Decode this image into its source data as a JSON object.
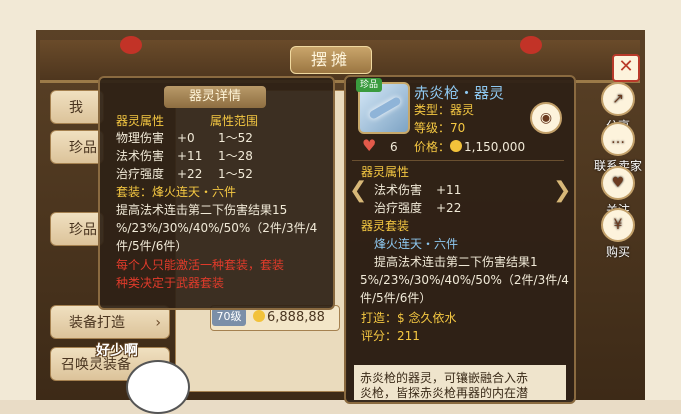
{
  "stall": {
    "title": "摆摊",
    "close_label": "✕"
  },
  "tabs": [
    {
      "label": "我"
    },
    {
      "label": "珍品"
    },
    {
      "label": "珍品"
    },
    {
      "label": "装备打造"
    },
    {
      "label": "召唤灵装备"
    }
  ],
  "shop": {
    "level": "70级",
    "price": "6,888,88"
  },
  "side_buttons": [
    {
      "label": "分享",
      "icon": "share-icon"
    },
    {
      "label": "联系卖家",
      "icon": "chat-icon"
    },
    {
      "label": "关注",
      "icon": "heart-icon"
    },
    {
      "label": "购买",
      "icon": "buy-icon"
    }
  ],
  "cat": {
    "text": "好少啊"
  },
  "spirit_detail": {
    "header": "器灵详情",
    "col1": "器灵属性",
    "col2": "属性范围",
    "rows": [
      {
        "name": "物理伤害",
        "value": "+0",
        "range": "1～52"
      },
      {
        "name": "法术伤害",
        "value": "+11",
        "range": "1～28"
      },
      {
        "name": "治疗强度",
        "value": "+22",
        "range": "1～52"
      }
    ],
    "set_line": "套装：烽火连天・六件",
    "set_desc_1": "提高法术连击第二下伤害结果15",
    "set_desc_2": "%/23%/30%/40%/50%（2件/3件/4",
    "set_desc_3": "件/5件/6件）",
    "warn_1": "每个人只能激活一种套装，套装",
    "warn_2": "种类决定于武器套装"
  },
  "weapon": {
    "name": "赤炎枪・器灵",
    "badge": "珍品",
    "type": "类型：器灵",
    "level": "等级：70",
    "likes": "6",
    "price_label": "价格：",
    "price": "1,150,000",
    "attr_title": "器灵属性",
    "attrs": [
      {
        "name": "法术伤害",
        "value": "+11"
      },
      {
        "name": "治疗强度",
        "value": "+22"
      }
    ],
    "set_title": "器灵套装",
    "set_name": "烽火连天・六件",
    "set_desc_1": "提高法术连击第二下伤害结果1",
    "set_desc_2": "5%/23%/30%/40%/50%（2件/3件/4",
    "set_desc_3": "件/5件/6件）",
    "maker": "打造：$ 念久依水",
    "score": "评分：211",
    "desc_1": "赤炎枪的器灵，可镶嵌融合入赤",
    "desc_2": "炎枪，皆探赤炎枪再器的内在潜"
  }
}
